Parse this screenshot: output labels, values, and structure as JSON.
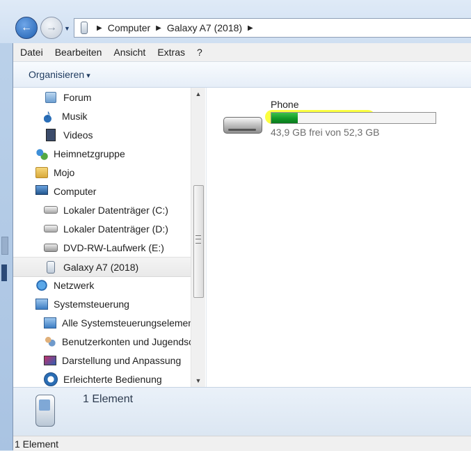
{
  "address": {
    "crumbs": [
      "Computer",
      "Galaxy A7 (2018)"
    ]
  },
  "menu": [
    "Datei",
    "Bearbeiten",
    "Ansicht",
    "Extras",
    "?"
  ],
  "toolbar": {
    "organize": "Organisieren"
  },
  "tree": [
    {
      "label": "Forum",
      "icon": "forum-icon",
      "indent": 2
    },
    {
      "label": "Musik",
      "icon": "music-icon",
      "indent": 2
    },
    {
      "label": "Videos",
      "icon": "video-icon",
      "indent": 2
    },
    {
      "label": "Heimnetzgruppe",
      "icon": "homegroup-icon",
      "indent": 1
    },
    {
      "label": "Mojo",
      "icon": "user-folder-icon",
      "indent": 1
    },
    {
      "label": "Computer",
      "icon": "computer-icon",
      "indent": 1
    },
    {
      "label": "Lokaler Datenträger (C:)",
      "icon": "hdd-icon",
      "indent": 2
    },
    {
      "label": "Lokaler Datenträger (D:)",
      "icon": "hdd-icon",
      "indent": 2
    },
    {
      "label": "DVD-RW-Laufwerk (E:)",
      "icon": "dvd-icon",
      "indent": 2
    },
    {
      "label": "Galaxy A7 (2018)",
      "icon": "phone-icon",
      "indent": 2,
      "selected": true
    },
    {
      "label": "Netzwerk",
      "icon": "network-icon",
      "indent": 1
    },
    {
      "label": "Systemsteuerung",
      "icon": "control-panel-icon",
      "indent": 1
    },
    {
      "label": "Alle Systemsteuerungselemente",
      "icon": "control-panel-icon",
      "indent": 2
    },
    {
      "label": "Benutzerkonten und Jugendschutz",
      "icon": "users-icon",
      "indent": 2
    },
    {
      "label": "Darstellung und Anpassung",
      "icon": "display-icon",
      "indent": 2
    },
    {
      "label": "Erleichterte Bedienung",
      "icon": "ease-of-access-icon",
      "indent": 2
    }
  ],
  "drive": {
    "name": "Phone",
    "free_text": "43,9 GB frei von 52,3 GB",
    "used_fraction": 0.161
  },
  "details": {
    "count": "1 Element"
  },
  "status": {
    "text": "1 Element"
  },
  "colors": {
    "highlight": "#fbff36",
    "bar_fill": "#119a28",
    "accent": "#1e5fb0"
  }
}
